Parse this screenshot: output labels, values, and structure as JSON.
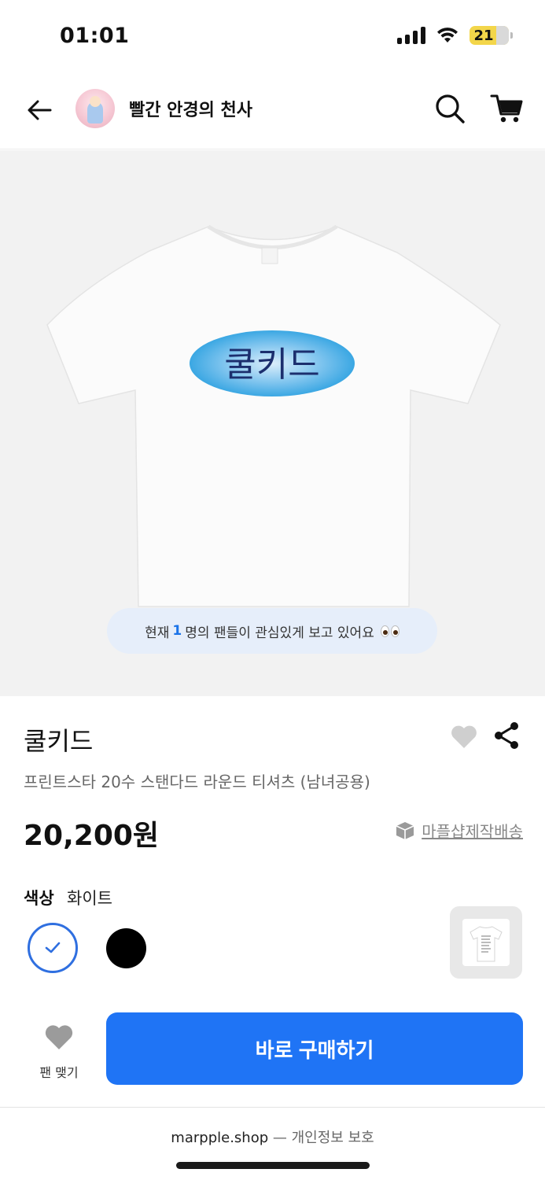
{
  "status_bar": {
    "time": "01:01",
    "battery": "21"
  },
  "header": {
    "store_name": "빨간 안경의 천사"
  },
  "product_image": {
    "print_text": "쿨키드",
    "viewers_prefix": "현재",
    "viewers_count": "1",
    "viewers_suffix": "명의 팬들이 관심있게 보고 있어요"
  },
  "product": {
    "title": "쿨키드",
    "subtitle": "프린트스타 20수 스탠다드 라운드 티셔츠 (남녀공용)",
    "price": "20,200원",
    "shipping": "마플샵제작배송"
  },
  "options": {
    "label": "색상",
    "selected_value": "화이트",
    "swatches": [
      "white",
      "black"
    ],
    "accent_color": "#2f6fe0"
  },
  "actions": {
    "fan_label": "팬 맺기",
    "buy_label": "바로 구매하기",
    "buy_color": "#1f74f5"
  },
  "footer": {
    "domain": "marpple.shop",
    "separator": "—",
    "privacy": "개인정보 보호"
  }
}
